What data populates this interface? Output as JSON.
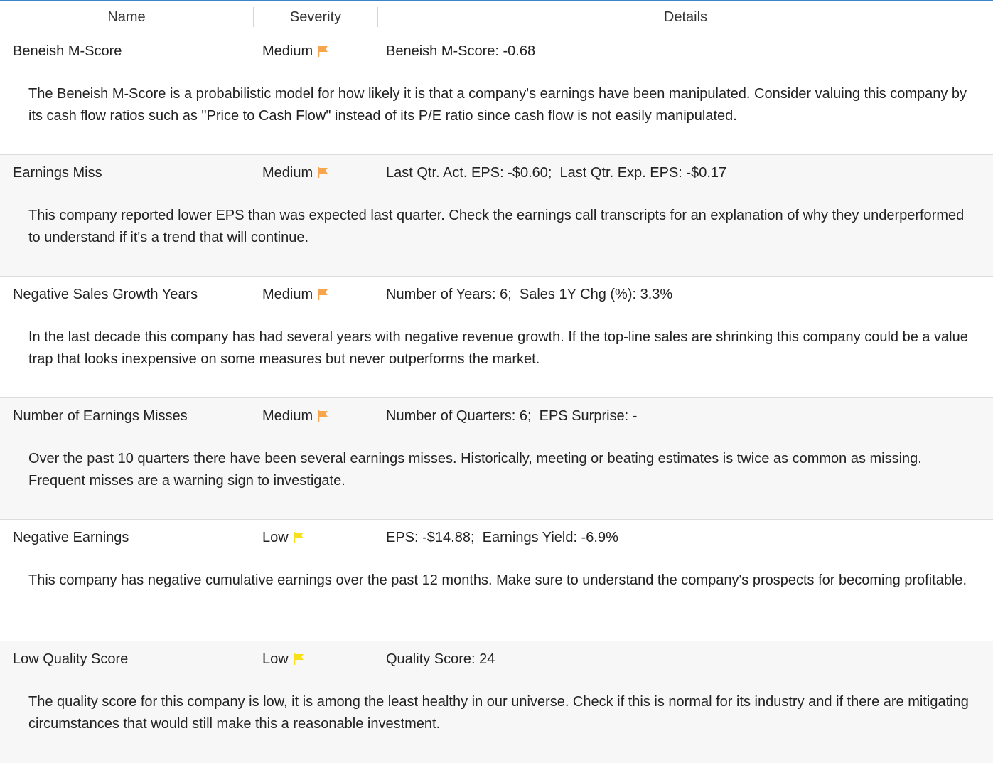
{
  "header": {
    "col_name": "Name",
    "col_severity": "Severity",
    "col_details": "Details"
  },
  "colors": {
    "accent": "#3a86c8",
    "medium_flag": "#f7a64d",
    "low_flag": "#f7e01a"
  },
  "rows": [
    {
      "name": "Beneish M-Score",
      "severity": "Medium",
      "flag_icon": "orange-flag-icon",
      "details": "Beneish M-Score: -0.68",
      "description": "The Beneish M-Score is a probabilistic model for how likely it is that a company's earnings have been manipulated. Consider valuing this company by its cash flow ratios such as \"Price to Cash Flow\" instead of its P/E ratio since cash flow is not easily manipulated."
    },
    {
      "name": "Earnings Miss",
      "severity": "Medium",
      "flag_icon": "orange-flag-icon",
      "details": "Last Qtr. Act. EPS: -$0.60;  Last Qtr. Exp. EPS: -$0.17",
      "description": "This company reported lower EPS than was expected last quarter. Check the earnings call transcripts for an explanation of why they underperformed to understand if it's a trend that will continue."
    },
    {
      "name": "Negative Sales Growth Years",
      "severity": "Medium",
      "flag_icon": "orange-flag-icon",
      "details": "Number of Years: 6;  Sales 1Y Chg (%): 3.3%",
      "description": "In the last decade this company has had several years with negative revenue growth. If the top-line sales are shrinking this company could be a value trap that looks inexpensive on some measures but never outperforms the market."
    },
    {
      "name": "Number of Earnings Misses",
      "severity": "Medium",
      "flag_icon": "orange-flag-icon",
      "details": "Number of Quarters: 6;  EPS Surprise: -",
      "description": "Over the past 10 quarters there have been several earnings misses. Historically, meeting or beating estimates is twice as common as missing. Frequent misses are a warning sign to investigate."
    },
    {
      "name": "Negative Earnings",
      "severity": "Low",
      "flag_icon": "yellow-flag-icon",
      "details": "EPS: -$14.88;  Earnings Yield: -6.9%",
      "description": "This company has negative cumulative earnings over the past 12 months. Make sure to understand the company's prospects for becoming profitable."
    },
    {
      "name": "Low Quality Score",
      "severity": "Low",
      "flag_icon": "yellow-flag-icon",
      "details": "Quality Score: 24",
      "description": "The quality score for this company is low, it is among the least healthy in our universe. Check if this is normal for its industry and if there are mitigating circumstances that would still make this a reasonable investment."
    }
  ]
}
